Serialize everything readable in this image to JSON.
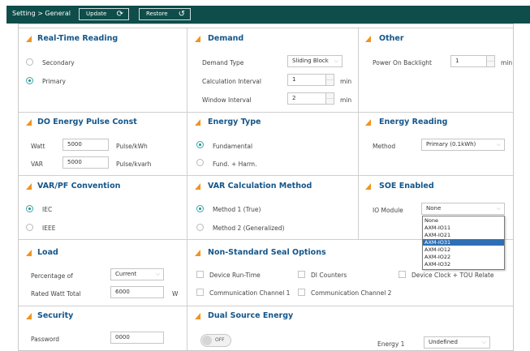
{
  "header": {
    "breadcrumb": "Setting > General",
    "update_label": "Update",
    "restore_label": "Restore"
  },
  "realtime": {
    "title": "Real-Time Reading",
    "option1": "Secondary",
    "option2": "Primary",
    "selected": "Primary"
  },
  "demand": {
    "title": "Demand",
    "type_label": "Demand Type",
    "type_value": "Sliding Block",
    "calc_label": "Calculation Interval",
    "calc_value": "1",
    "calc_unit": "min",
    "window_label": "Window Interval",
    "window_value": "2",
    "window_unit": "min"
  },
  "other": {
    "title": "Other",
    "backlight_label": "Power On Backlight",
    "backlight_value": "1",
    "backlight_unit": "min"
  },
  "do_pulse": {
    "title": "DO Energy Pulse Const",
    "watt_label": "Watt",
    "watt_value": "5000",
    "watt_unit": "Pulse/kWh",
    "var_label": "VAR",
    "var_value": "5000",
    "var_unit": "Pulse/kvarh"
  },
  "energy_type": {
    "title": "Energy Type",
    "option1": "Fundamental",
    "option2": "Fund. + Harm.",
    "selected": "Fundamental"
  },
  "energy_reading": {
    "title": "Energy Reading",
    "method_label": "Method",
    "method_value": "Primary (0.1kWh)"
  },
  "varpf": {
    "title": "VAR/PF Convention",
    "option1": "IEC",
    "option2": "IEEE",
    "selected": "IEC"
  },
  "var_calc": {
    "title": "VAR Calculation Method",
    "option1": "Method 1 (True)",
    "option2": "Method 2 (Generalized)",
    "selected": "Method 1 (True)"
  },
  "soe": {
    "title": "SOE Enabled",
    "io_label": "IO Module",
    "io_value": "None",
    "options": [
      "None",
      "AXM-IO11",
      "AXM-IO21",
      "AXM-IO31",
      "AXM-IO12",
      "AXM-IO22",
      "AXM-IO32"
    ],
    "highlighted": "AXM-IO31"
  },
  "load": {
    "title": "Load",
    "pct_label": "Percentage of",
    "pct_value": "Current",
    "rated_label": "Rated Watt Total",
    "rated_value": "6000",
    "rated_unit": "W"
  },
  "seal": {
    "title": "Non-Standard Seal Options",
    "opt1": "Device Run-Time",
    "opt2": "DI Counters",
    "opt3": "Device Clock + TOU Relate",
    "opt4": "Communication Channel 1",
    "opt5": "Communication Channel 2"
  },
  "security": {
    "title": "Security",
    "pw_label": "Password",
    "pw_value": "0000"
  },
  "dual": {
    "title": "Dual Source Energy",
    "toggle_label": "OFF",
    "energy_label": "Energy 1",
    "energy_value": "Undefined"
  },
  "colors": {
    "header_bg": "#0e4d4a",
    "title_text": "#14568a",
    "accent_triangle": "#f0941e",
    "selection": "#2f6fb5"
  }
}
